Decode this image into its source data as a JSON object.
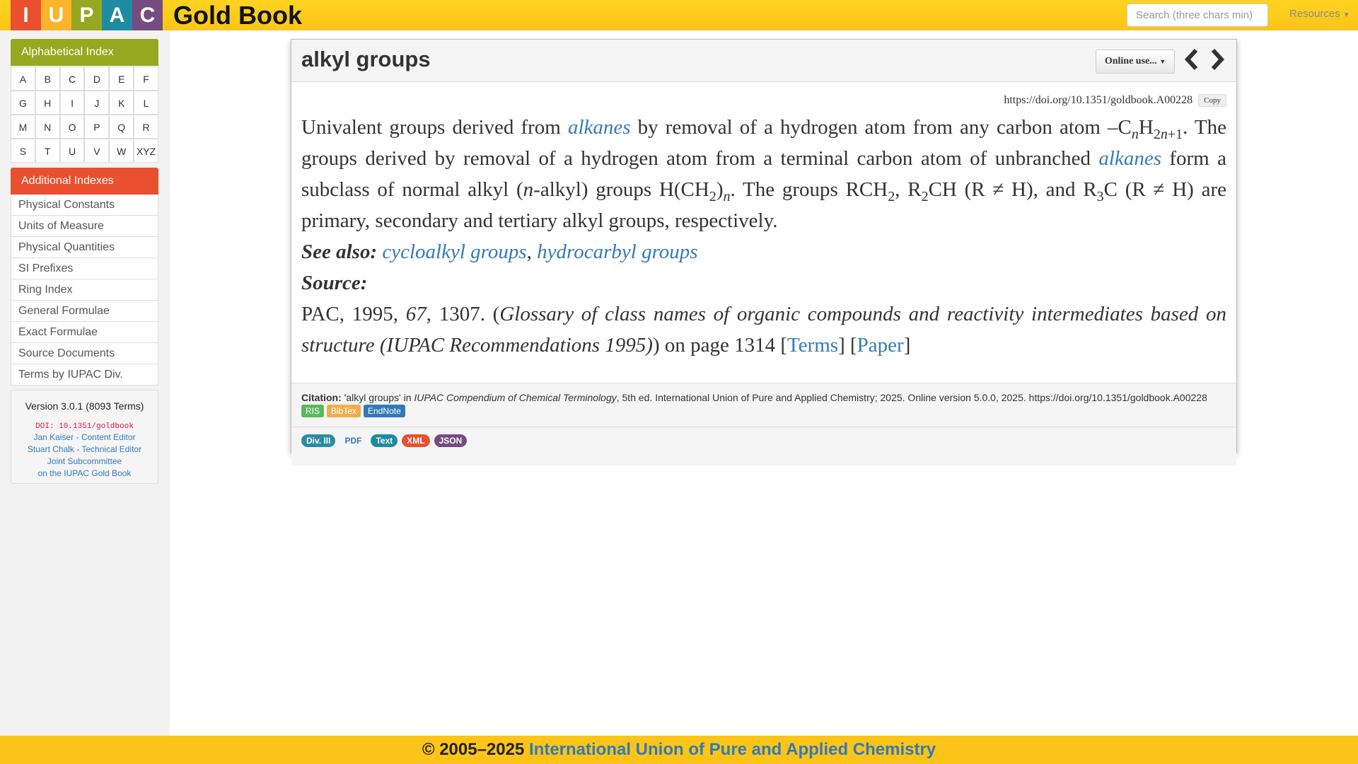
{
  "header": {
    "logo_letters": [
      "I",
      "U",
      "P",
      "A",
      "C"
    ],
    "logo_colors": [
      "#e9502f",
      "#fbb42c",
      "#96a81f",
      "#1d8ba2",
      "#754b81"
    ],
    "title": "Gold Book",
    "search_placeholder": "Search (three chars min)",
    "resources_label": "Resources"
  },
  "sidebar": {
    "alpha_heading": "Alphabetical Index",
    "letters": [
      "A",
      "B",
      "C",
      "D",
      "E",
      "F",
      "G",
      "H",
      "I",
      "J",
      "K",
      "L",
      "M",
      "N",
      "O",
      "P",
      "Q",
      "R",
      "S",
      "T",
      "U",
      "V",
      "W",
      "XYZ"
    ],
    "additional_heading": "Additional Indexes",
    "additional_items": [
      "Physical Constants",
      "Units of Measure",
      "Physical Quantities",
      "SI Prefixes",
      "Ring Index",
      "General Formulae",
      "Exact Formulae",
      "Source Documents",
      "Terms by IUPAC Div."
    ],
    "version": "Version 3.0.1 (8093 Terms)",
    "doi": "DOI: 10.1351/goldbook",
    "credits": [
      "Jan Kaiser - Content Editor",
      "Stuart Chalk - Technical Editor",
      "Joint Subcommittee",
      "on the IUPAC Gold Book"
    ]
  },
  "entry": {
    "title": "alkyl groups",
    "online_use_label": "Online use...",
    "doi_url": "https://doi.org/10.1351/goldbook.A00228",
    "copy_label": "Copy",
    "def_text_1": "Univalent groups derived from ",
    "link_alkanes": "alkanes",
    "def_text_2": " by removal of a hydrogen atom from any carbon atom –C",
    "def_n": "n",
    "def_text_3": "H",
    "def_sub_2n1": "2n+1",
    "def_text_4": ". The groups derived by removal of a hydrogen atom from a terminal carbon atom of unbranched ",
    "def_text_5": " form a subclass of normal alkyl (",
    "def_text_6": "-alkyl) groups H(CH",
    "sub_2": "2",
    "sub_3": "3",
    "def_text_7": ")",
    "def_text_8": ". The groups RCH",
    "def_text_9": ", R",
    "def_text_10": "CH (R ≠ H), and R",
    "def_text_11": "C (R ≠ H) are primary, secondary and tertiary alkyl groups, respectively.",
    "see_also_label": "See also:",
    "see_also_links": [
      "cycloalkyl groups",
      "hydrocarbyl groups"
    ],
    "see_also_sep": ",",
    "source_label": "Source:",
    "source_journal": "PAC, 1995, ",
    "source_volume": "67",
    "source_pages": ", 1307. (",
    "source_title": "Glossary of class names of organic compounds and reactivity intermediates based on structure (IUPAC Recommendations 1995)",
    "source_page_text": ") on page 1314 [",
    "terms_link": "Terms",
    "bracket_mid": "] [",
    "paper_link": "Paper",
    "bracket_end": "]"
  },
  "citation": {
    "label": "Citation:",
    "text_1": " 'alkyl groups' in ",
    "work": "IUPAC Compendium of Chemical Terminology",
    "text_2": ", 5th ed. International Union of Pure and Applied Chemistry; 2025. Online version 5.0.0, 2025. https://doi.org/10.1351/goldbook.A00228",
    "buttons": [
      {
        "label": "RIS",
        "color": "#5cb85c"
      },
      {
        "label": "BibTex",
        "color": "#f0ad4e"
      },
      {
        "label": "EndNote",
        "color": "#337ab7"
      }
    ]
  },
  "formats": [
    {
      "label": "Div. III",
      "color": "#2a8ca3"
    },
    {
      "label": "PDF",
      "color": "transparent"
    },
    {
      "label": "Text",
      "color": "#1d8ba2"
    },
    {
      "label": "XML",
      "color": "#e9502f"
    },
    {
      "label": "JSON",
      "color": "#754b81"
    }
  ],
  "footer": {
    "copyright": "© 2005–2025 ",
    "org": "International Union of Pure and Applied Chemistry"
  }
}
